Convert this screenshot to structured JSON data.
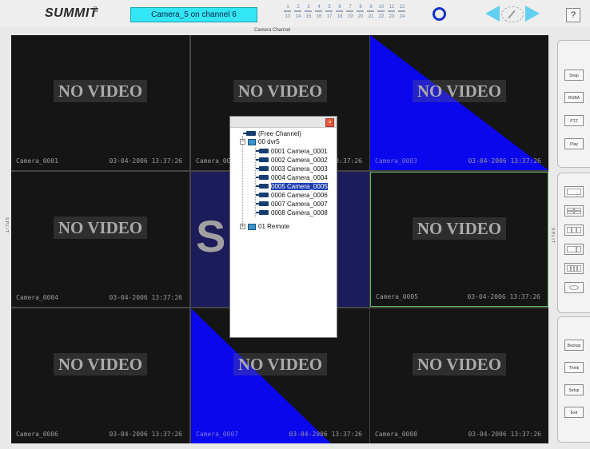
{
  "header": {
    "logo": "SUMMIT",
    "logo_mark": "&",
    "status": "Camera_5 on channel 6",
    "channel_numbers_top": [
      "1",
      "2",
      "3",
      "4",
      "5",
      "6",
      "7",
      "8",
      "9",
      "10",
      "11",
      "12"
    ],
    "channel_numbers_bottom": [
      "13",
      "14",
      "15",
      "16",
      "17",
      "18",
      "19",
      "20",
      "21",
      "22",
      "23",
      "24"
    ],
    "help_label": "?",
    "camera_channel_label": "Camera   Channel"
  },
  "cells": [
    {
      "title": "NO VIDEO",
      "name": "Camera_0001",
      "time": "03-04-2006 13:37:26"
    },
    {
      "title": "NO VIDEO",
      "name": "Camera_0002",
      "time": "03-04-2006 13:37:26"
    },
    {
      "title": "NO VIDEO",
      "name": "Camera_0003",
      "time": "03-04-2006 13:37:26"
    },
    {
      "title": "NO VIDEO",
      "name": "Camera_0004",
      "time": "03-04-2006 13:37:26"
    },
    {
      "title": "S",
      "name": "",
      "time": ""
    },
    {
      "title": "NO VIDEO",
      "name": "Camera_0005",
      "time": "03-04-2006 13:37:26"
    },
    {
      "title": "NO VIDEO",
      "name": "Camera_0006",
      "time": "03-04-2006 13:37:26"
    },
    {
      "title": "NO VIDEO",
      "name": "Camera_0007",
      "time": "03-04-2006 13:37:26"
    },
    {
      "title": "NO VIDEO",
      "name": "Camera_0008",
      "time": "03-04-2006 13:37:26"
    }
  ],
  "side_labels": {
    "left": "S P L I T",
    "right": "S P L I T"
  },
  "right_panel": {
    "buttons_top": [
      "Snap",
      "RGBA",
      "PTZ",
      "Play"
    ],
    "buttons_bottom": [
      "Backup",
      "Think",
      "Setup",
      "Exit"
    ]
  },
  "popup": {
    "close": "×",
    "free_channel": "(Free Channel)",
    "group1": "00 dvr5",
    "cameras": [
      "0001 Camera_0001",
      "0002 Camera_0002",
      "0003 Camera_0003",
      "0004 Camera_0004",
      "0005 Camera_0005",
      "0006 Camera_0006",
      "0007 Camera_0007",
      "0008 Camera_0008"
    ],
    "group2": "01 Remote"
  },
  "colors": {
    "blue_overlay": "#0a06ee",
    "status_bg": "#33e6f5",
    "selected_border": "#5fb85f"
  }
}
